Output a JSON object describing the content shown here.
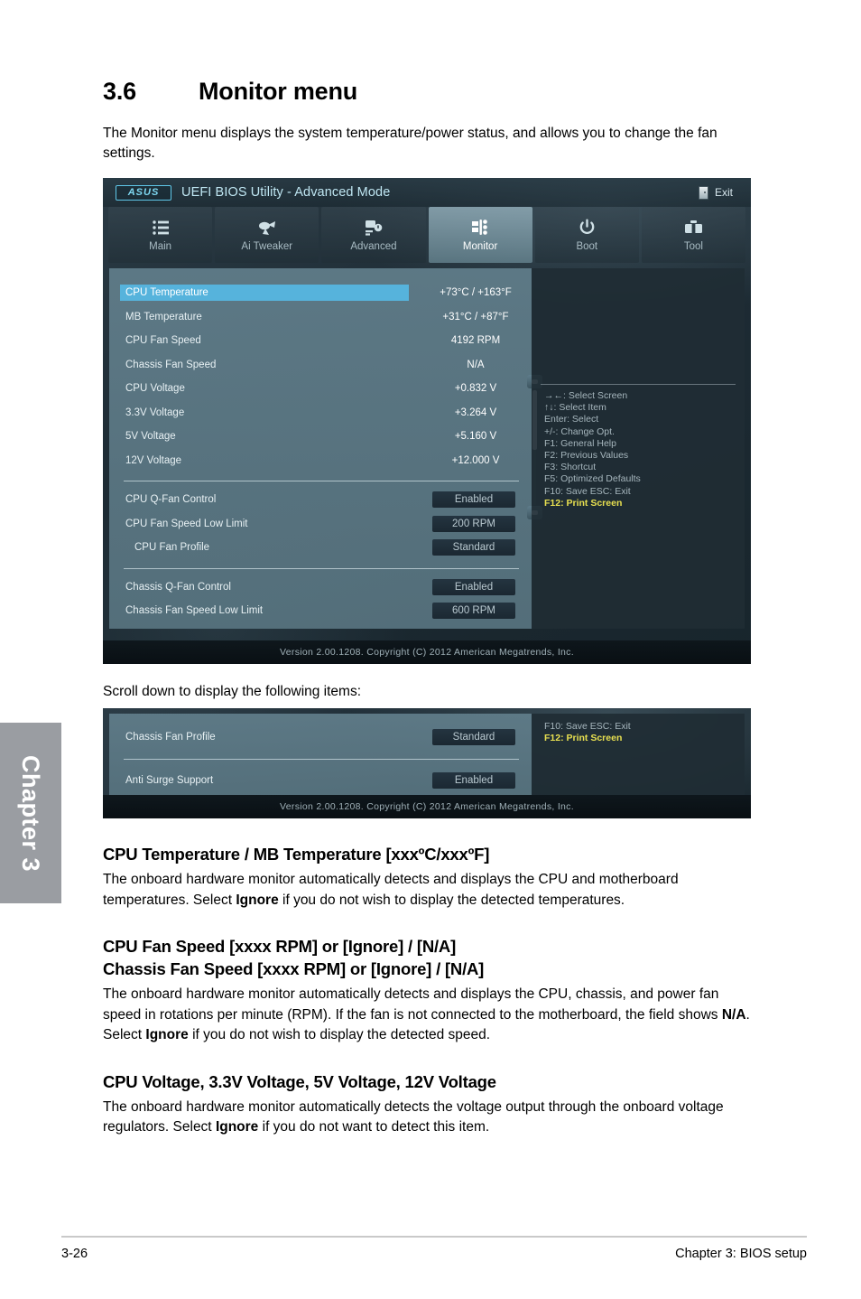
{
  "document": {
    "section_number": "3.6",
    "section_title": "Monitor menu",
    "intro": "The Monitor menu displays the system temperature/power status, and allows you to change the fan settings.",
    "scroll_note": "Scroll down to display the following items:",
    "chapter_tab": "Chapter 3",
    "footer_page": "3-26",
    "footer_chapter": "Chapter 3: BIOS setup"
  },
  "bios": {
    "logo": "ASUS",
    "title": "UEFI BIOS Utility - Advanced Mode",
    "exit_label": "Exit",
    "version_line": "Version  2.00.1208.   Copyright  (C)  2012  American  Megatrends,  Inc.",
    "tabs": [
      {
        "label": "Main",
        "icon": "list-icon",
        "active": false
      },
      {
        "label": "Ai  Tweaker",
        "icon": "tweak-icon",
        "active": false
      },
      {
        "label": "Advanced",
        "icon": "advanced-icon",
        "active": false
      },
      {
        "label": "Monitor",
        "icon": "monitor-icon",
        "active": true
      },
      {
        "label": "Boot",
        "icon": "power-icon",
        "active": false
      },
      {
        "label": "Tool",
        "icon": "toolbox-icon",
        "active": false
      }
    ],
    "readouts": [
      {
        "label": "CPU Temperature",
        "value": "+73°C / +163°F",
        "selected": true
      },
      {
        "label": "MB Temperature",
        "value": "+31°C / +87°F",
        "selected": false
      },
      {
        "label": "CPU Fan Speed",
        "value": "4192 RPM",
        "selected": false
      },
      {
        "label": "Chassis Fan Speed",
        "value": "N/A",
        "selected": false
      },
      {
        "label": "CPU Voltage",
        "value": "+0.832 V",
        "selected": false
      },
      {
        "label": "3.3V Voltage",
        "value": "+3.264 V",
        "selected": false
      },
      {
        "label": "5V Voltage",
        "value": "+5.160 V",
        "selected": false
      },
      {
        "label": "12V Voltage",
        "value": "+12.000 V",
        "selected": false
      }
    ],
    "cpu_fan_group": [
      {
        "label": "CPU Q-Fan Control",
        "option": "Enabled",
        "indent": false
      },
      {
        "label": "CPU Fan Speed Low Limit",
        "option": "200 RPM",
        "indent": false
      },
      {
        "label": "CPU Fan Profile",
        "option": "Standard",
        "indent": true
      }
    ],
    "chassis_fan_group": [
      {
        "label": "Chassis Q-Fan Control",
        "option": "Enabled",
        "indent": false
      },
      {
        "label": "Chassis Fan Speed Low Limit",
        "option": "600 RPM",
        "indent": false
      }
    ],
    "help_lines": [
      {
        "text": "→←:  Select Screen",
        "highlight": false
      },
      {
        "text": "↑↓:  Select Item",
        "highlight": false
      },
      {
        "text": "Enter:  Select",
        "highlight": false
      },
      {
        "text": "+/-:  Change Opt.",
        "highlight": false
      },
      {
        "text": "F1:  General Help",
        "highlight": false
      },
      {
        "text": "F2:  Previous Values",
        "highlight": false
      },
      {
        "text": "F3:  Shortcut",
        "highlight": false
      },
      {
        "text": "F5:  Optimized Defaults",
        "highlight": false
      },
      {
        "text": "F10:  Save    ESC:  Exit",
        "highlight": false
      },
      {
        "text": "F12: Print Screen",
        "highlight": true
      }
    ]
  },
  "bios_scrolled": {
    "rows": [
      {
        "label": "Chassis Fan Profile",
        "option": "Standard"
      },
      {
        "label": "Anti Surge Support",
        "option": "Enabled"
      }
    ],
    "help_lines": [
      {
        "text": "F10:  Save    ESC:  Exit",
        "highlight": false
      },
      {
        "text": "F12: Print Screen",
        "highlight": true
      }
    ],
    "version_line": "Version  2.00.1208.   Copyright  (C)  2012  American  Megatrends,  Inc."
  },
  "sections": [
    {
      "heading": "CPU Temperature / MB Temperature [xxxºC/xxxºF]",
      "heading2": "",
      "body_parts": [
        {
          "t": "The onboard hardware monitor automatically detects and displays the CPU and motherboard temperatures. Select ",
          "b": false
        },
        {
          "t": "Ignore",
          "b": true
        },
        {
          "t": " if you do not wish to display the detected temperatures.",
          "b": false
        }
      ]
    },
    {
      "heading": "CPU Fan Speed [xxxx RPM] or [Ignore] / [N/A]",
      "heading2": "Chassis Fan Speed [xxxx RPM] or [Ignore] / [N/A]",
      "body_parts": [
        {
          "t": "The onboard hardware monitor automatically detects and displays the CPU, chassis, and power fan speed in rotations per minute (RPM). If the fan is not connected to the motherboard, the field shows ",
          "b": false
        },
        {
          "t": "N/A",
          "b": true
        },
        {
          "t": ". Select ",
          "b": false
        },
        {
          "t": "Ignore",
          "b": true
        },
        {
          "t": " if you do not wish to display the detected speed.",
          "b": false
        }
      ]
    },
    {
      "heading": "CPU Voltage, 3.3V Voltage, 5V Voltage, 12V Voltage",
      "heading2": "",
      "body_parts": [
        {
          "t": "The onboard hardware monitor automatically detects the voltage output through the onboard voltage regulators. Select ",
          "b": false
        },
        {
          "t": "Ignore",
          "b": true
        },
        {
          "t": " if you do not want to detect this item.",
          "b": false
        }
      ]
    }
  ]
}
